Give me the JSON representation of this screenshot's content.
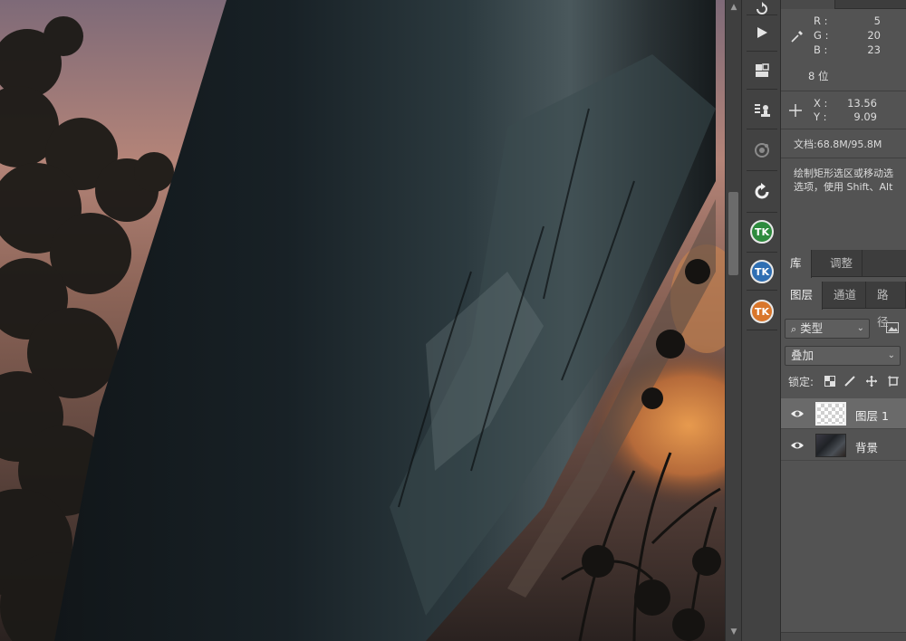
{
  "info_panel": {
    "r_label": "R :",
    "r_value": "5",
    "g_label": "G :",
    "g_value": "20",
    "b_label": "B :",
    "b_value": "23",
    "bit_depth": "8 位",
    "x_label": "X :",
    "x_value": "13.56",
    "y_label": "Y :",
    "y_value": "9.09",
    "doc_size": "文档:68.8M/95.8M",
    "hint_line1": "绘制矩形选区或移动选",
    "hint_line2": "选项，使用 Shift、Alt"
  },
  "dock": {
    "icons": [
      "rotate-icon",
      "play-icon",
      "3d-cube-icon",
      "stamp-list-icon",
      "pattern-icon",
      "refresh-icon",
      "tk-green-icon",
      "tk-blue-icon",
      "tk-orange-icon"
    ],
    "tk_label": "TK"
  },
  "tabs_top": {
    "library": "库",
    "adjust": "调整"
  },
  "tabs_layers": {
    "layers": "图层",
    "channels": "通道",
    "paths": "路径"
  },
  "layers_panel": {
    "filter_kind": "类型",
    "blend_mode": "叠加",
    "lock_label": "锁定:",
    "layers": [
      {
        "name": "图层 1",
        "visible": true,
        "selected": true
      },
      {
        "name": "背景",
        "visible": true,
        "selected": false
      }
    ]
  },
  "colors": {
    "panel_bg": "#535353",
    "dock_bg": "#424242",
    "tk_green": "#2e8b3e",
    "tk_blue": "#2f6fb3",
    "tk_orange": "#d9762b"
  }
}
